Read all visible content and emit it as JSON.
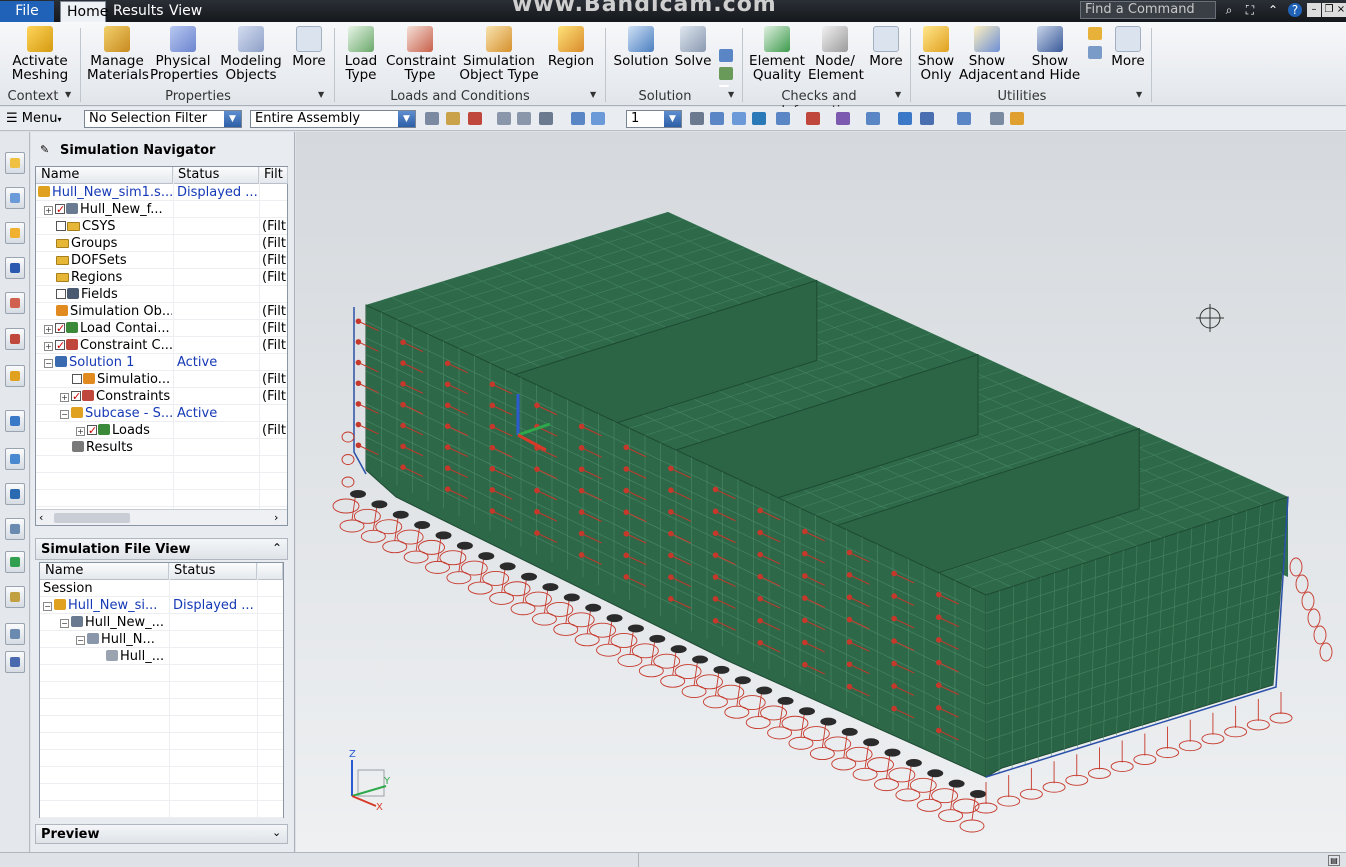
{
  "menu_tabs": {
    "file": "File",
    "home": "Home",
    "results": "Results",
    "view": "View"
  },
  "watermark": "www.Bandicam.com",
  "find_command": {
    "placeholder": "Find a Command"
  },
  "ribbon": {
    "activate_meshing": "Activate Meshing",
    "manage_materials": "Manage Materials",
    "physical_properties": "Physical Properties",
    "modeling_objects": "Modeling Objects",
    "more1": "More",
    "load_type": "Load Type",
    "constraint_type": "Constraint Type",
    "simulation_object_type": "Simulation Object Type",
    "region": "Region",
    "solution": "Solution",
    "solve": "Solve",
    "element_quality": "Element Quality",
    "node_element": "Node/ Element",
    "more2": "More",
    "show_only": "Show Only",
    "show_adjacent": "Show Adjacent",
    "show_and_hide": "Show and Hide",
    "more3": "More",
    "groups": {
      "context": "Context",
      "properties": "Properties",
      "loads_and_conditions": "Loads and Conditions",
      "solution": "Solution",
      "checks_and_information": "Checks and Information",
      "utilities": "Utilities"
    }
  },
  "toolbar": {
    "menu": "Menu",
    "selection_filter": "No Selection Filter",
    "scope": "Entire Assembly",
    "layer": "1"
  },
  "navigator": {
    "title": "Simulation Navigator",
    "columns": [
      "Name",
      "Status",
      "Filt"
    ],
    "rows": [
      {
        "name": "Hull_New_sim1.s...",
        "status": "Displayed ...",
        "filter": ""
      },
      {
        "name": "Hull_New_f...",
        "status": "",
        "filter": ""
      },
      {
        "name": "CSYS",
        "status": "",
        "filter": "(Filt"
      },
      {
        "name": "Groups",
        "status": "",
        "filter": "(Filt"
      },
      {
        "name": "DOFSets",
        "status": "",
        "filter": "(Filt"
      },
      {
        "name": "Regions",
        "status": "",
        "filter": "(Filt"
      },
      {
        "name": "Fields",
        "status": "",
        "filter": ""
      },
      {
        "name": "Simulation Ob...",
        "status": "",
        "filter": "(Filt"
      },
      {
        "name": "Load Contai...",
        "status": "",
        "filter": "(Filt"
      },
      {
        "name": "Constraint C...",
        "status": "",
        "filter": "(Filt"
      },
      {
        "name": "Solution 1",
        "status": "Active",
        "filter": ""
      },
      {
        "name": "Simulatio...",
        "status": "",
        "filter": "(Filt"
      },
      {
        "name": "Constraints",
        "status": "",
        "filter": "(Filt"
      },
      {
        "name": "Subcase - S...",
        "status": "Active",
        "filter": ""
      },
      {
        "name": "Loads",
        "status": "",
        "filter": "(Filt"
      },
      {
        "name": "Results",
        "status": "",
        "filter": ""
      }
    ]
  },
  "file_view": {
    "title": "Simulation File View",
    "columns": [
      "Name",
      "Status"
    ],
    "rows": [
      {
        "name": "Session",
        "status": ""
      },
      {
        "name": "Hull_New_si...",
        "status": "Displayed ..."
      },
      {
        "name": "Hull_New_...",
        "status": ""
      },
      {
        "name": "Hull_N...",
        "status": ""
      },
      {
        "name": "Hull_...",
        "status": ""
      }
    ]
  },
  "preview": {
    "title": "Preview"
  },
  "axes": {
    "x": "X",
    "y": "Y",
    "z": "Z"
  },
  "colors": {
    "hull": "#2c6647",
    "constraint": "#c6382b",
    "accent": "#1f62b8"
  }
}
